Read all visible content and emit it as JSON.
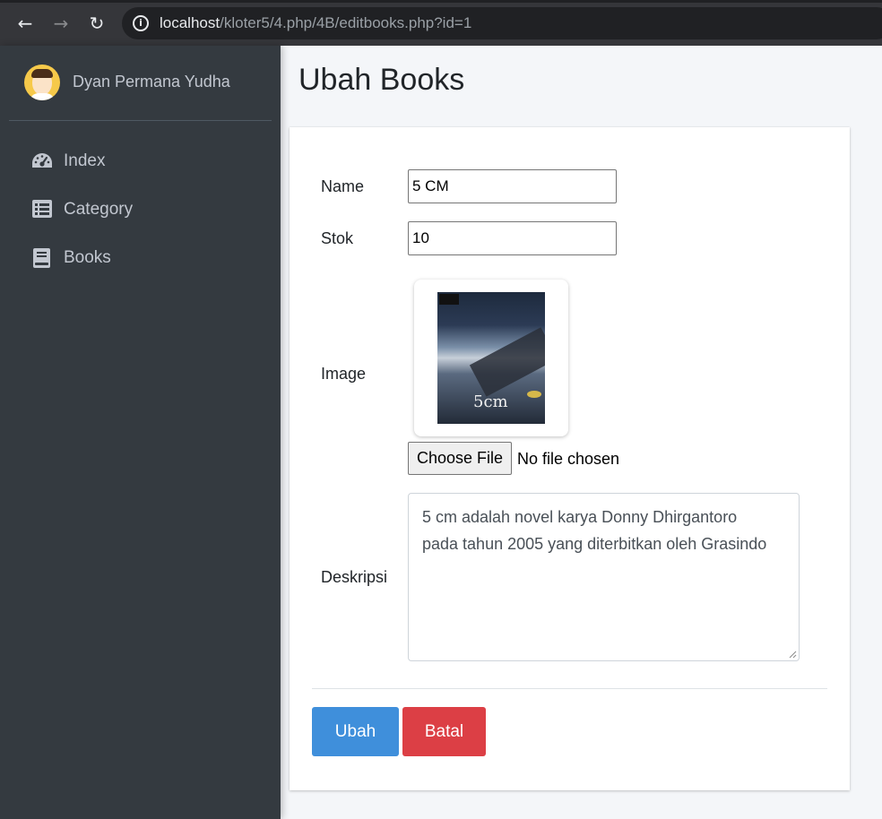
{
  "browser": {
    "back_icon": "arrow-left-icon",
    "forward_icon": "arrow-right-icon",
    "reload_icon": "reload-icon",
    "site_info_icon": "info-icon",
    "url_host": "localhost",
    "url_path": "/kloter5/4.php/4B/editbooks.php?id=1"
  },
  "sidebar": {
    "user_name": "Dyan Permana Yudha",
    "items": [
      {
        "label": "Index",
        "icon": "tachometer-icon"
      },
      {
        "label": "Category",
        "icon": "list-icon"
      },
      {
        "label": "Books",
        "icon": "book-icon"
      }
    ],
    "colors": {
      "background": "#343a40",
      "text": "#c2c7d0"
    }
  },
  "main": {
    "title": "Ubah Books",
    "form": {
      "name_label": "Name",
      "name_value": "5 CM",
      "stok_label": "Stok",
      "stok_value": "10",
      "image_label": "Image",
      "image_cover_text": "5cm",
      "file_button_label": "Choose File",
      "file_status": "No file chosen",
      "deskripsi_label": "Deskripsi",
      "deskripsi_line1": "5 cm adalah novel karya Donny Dhirgantoro",
      "deskripsi_line2": "pada tahun 2005 yang diterbitkan oleh Grasindo"
    },
    "buttons": {
      "submit_label": "Ubah",
      "cancel_label": "Batal"
    },
    "colors": {
      "primary": "#3f8fdb",
      "danger": "#dc3f45",
      "page_bg": "#f4f6f9"
    }
  }
}
